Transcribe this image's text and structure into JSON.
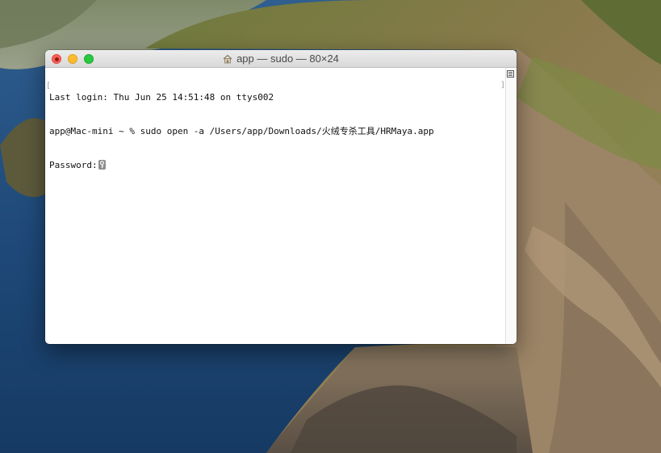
{
  "window": {
    "title": "app — sudo — 80×24"
  },
  "terminal": {
    "lines": [
      "Last login: Thu Jun 25 14:51:48 on ttys002",
      "app@Mac-mini ~ % sudo open -a /Users/app/Downloads/火绒专杀工具/HRMaya.app",
      "Password:"
    ]
  },
  "icons": {
    "title_icon": "home-folder-icon",
    "cursor": "password-key-icon",
    "split": "split-pane-icon"
  },
  "colors": {
    "close": "#fc5f57",
    "minimize": "#fdbc2e",
    "zoom": "#28c840",
    "terminal_bg": "#ffffff",
    "terminal_text": "#111111"
  }
}
